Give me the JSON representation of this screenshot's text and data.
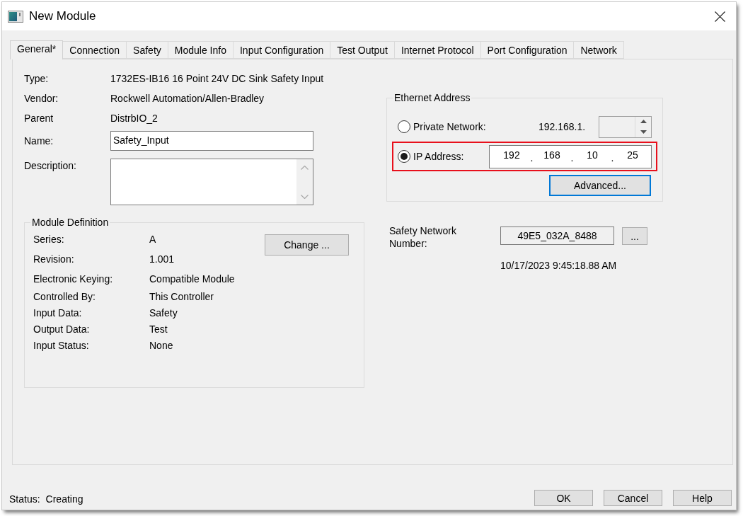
{
  "window": {
    "title": "New Module"
  },
  "tabs": [
    {
      "label": "General*",
      "selected": true
    },
    {
      "label": "Connection",
      "selected": false
    },
    {
      "label": "Safety",
      "selected": false
    },
    {
      "label": "Module Info",
      "selected": false
    },
    {
      "label": "Input Configuration",
      "selected": false
    },
    {
      "label": "Test Output",
      "selected": false
    },
    {
      "label": "Internet Protocol",
      "selected": false
    },
    {
      "label": "Port Configuration",
      "selected": false
    },
    {
      "label": "Network",
      "selected": false
    }
  ],
  "general": {
    "details": [
      {
        "label": "Type:",
        "value": "1732ES-IB16 16 Point 24V DC Sink Safety Input"
      },
      {
        "label": "Vendor:",
        "value": "Rockwell Automation/Allen-Bradley"
      },
      {
        "label": "Parent",
        "value": "DistrbIO_2"
      }
    ],
    "name": {
      "label": "Name:",
      "value": "Safety_Input"
    },
    "description": {
      "label": "Description:"
    },
    "module_definition": {
      "title": "Module Definition",
      "rows": [
        {
          "label": "Series:",
          "value": "A"
        },
        {
          "label": "Revision:",
          "value": "1.001"
        },
        {
          "label": "Electronic Keying:",
          "value": "Compatible Module"
        },
        {
          "label": "Controlled By:",
          "value": "This Controller"
        },
        {
          "label": "Input Data:",
          "value": "Safety"
        },
        {
          "label": "Output Data:",
          "value": "Test"
        },
        {
          "label": "Input Status:",
          "value": "None"
        }
      ],
      "change_button": "Change ..."
    },
    "ethernet_address": {
      "title": "Ethernet Address",
      "options": [
        {
          "kind": "private_network",
          "label": "Private Network:",
          "selected": false,
          "highlighted": false,
          "prefix": "192.168.1.",
          "host_disabled": true
        },
        {
          "kind": "ip_address",
          "label": "IP Address:",
          "selected": true,
          "highlighted": true,
          "octets": [
            "192",
            "168",
            "10",
            "25"
          ],
          "separator": "."
        }
      ],
      "advanced_button": {
        "label": "Advanced...",
        "focused": true
      }
    },
    "safety_network_number": {
      "label": "Safety Network Number:",
      "value": "49E5_032A_8488",
      "button": "...",
      "timestamp": "10/17/2023 9:45:18.88 AM"
    }
  },
  "status": {
    "label": "Status:",
    "value": "Creating"
  },
  "buttons": [
    "OK",
    "Cancel",
    "Help"
  ]
}
